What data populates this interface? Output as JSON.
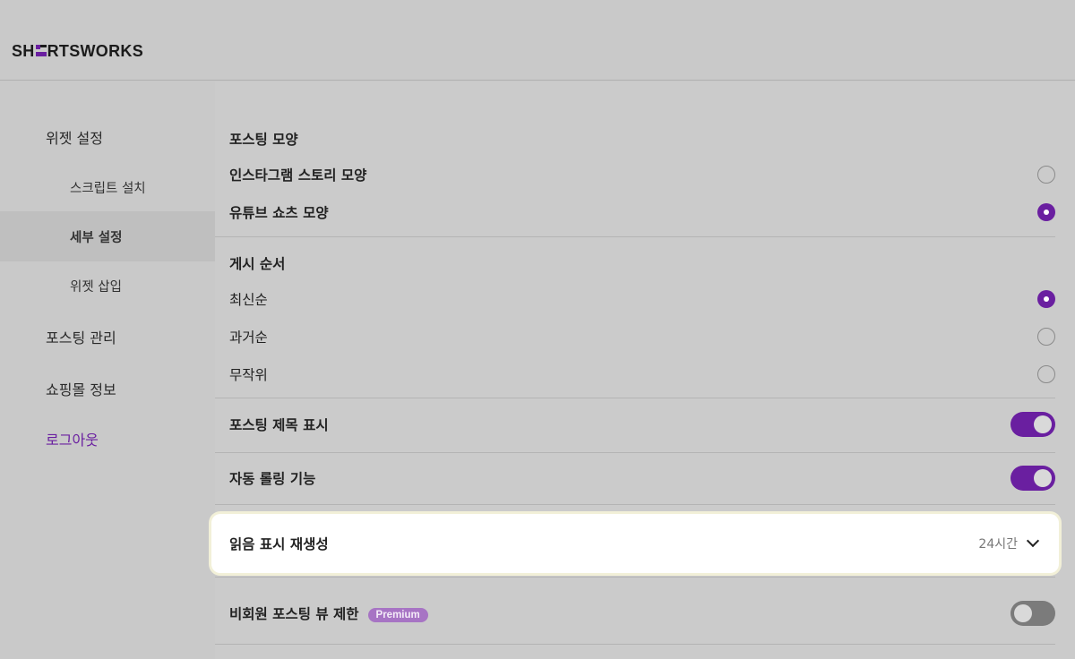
{
  "brand": {
    "logo_left": "SH",
    "logo_right": "RTSWORKS",
    "accent_color": "#6a1fa0"
  },
  "sidebar": {
    "items": [
      {
        "label": "위젯 설정",
        "level": "top",
        "active": false
      },
      {
        "label": "스크립트 설치",
        "level": "sub",
        "active": false
      },
      {
        "label": "세부 설정",
        "level": "sub",
        "active": true
      },
      {
        "label": "위젯 삽입",
        "level": "sub",
        "active": false
      },
      {
        "label": "포스팅 관리",
        "level": "top",
        "active": false
      },
      {
        "label": "쇼핑몰 정보",
        "level": "top",
        "active": false
      },
      {
        "label": "로그아웃",
        "level": "top",
        "active": false
      }
    ]
  },
  "settings": {
    "posting_shape": {
      "title": "포스팅 모양",
      "options": [
        {
          "label": "인스타그램 스토리 모양",
          "selected": false
        },
        {
          "label": "유튜브 쇼츠 모양",
          "selected": true
        }
      ]
    },
    "posting_order": {
      "title": "게시 순서",
      "options": [
        {
          "label": "최신순",
          "selected": true
        },
        {
          "label": "과거순",
          "selected": false
        },
        {
          "label": "무작위",
          "selected": false
        }
      ]
    },
    "show_title": {
      "label": "포스팅 제목 표시",
      "enabled": true
    },
    "auto_rolling": {
      "label": "자동 롤링 기능",
      "enabled": true
    },
    "read_regen": {
      "label": "읽음 표시 재생성",
      "value": "24시간"
    },
    "guest_limit": {
      "label": "비회원 포스팅 뷰 제한",
      "badge": "Premium",
      "enabled": false
    }
  }
}
